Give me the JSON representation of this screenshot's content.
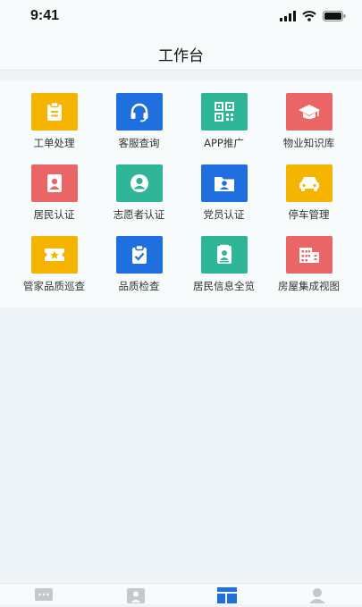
{
  "status_bar": {
    "time": "9:41"
  },
  "header": {
    "title": "工作台"
  },
  "grid": {
    "items": [
      {
        "label": "工单处理",
        "icon": "clipboard-icon",
        "color": "#f4b400"
      },
      {
        "label": "客服查询",
        "icon": "headset-icon",
        "color": "#1f6fde"
      },
      {
        "label": "APP推广",
        "icon": "qrcode-icon",
        "color": "#2fb597"
      },
      {
        "label": "物业知识库",
        "icon": "graduation-cap-icon",
        "color": "#ea6666"
      },
      {
        "label": "居民认证",
        "icon": "id-badge-icon",
        "color": "#ea6666"
      },
      {
        "label": "志愿者认证",
        "icon": "user-circle-icon",
        "color": "#2fb597"
      },
      {
        "label": "党员认证",
        "icon": "folder-user-icon",
        "color": "#1f6fde"
      },
      {
        "label": "停车管理",
        "icon": "car-icon",
        "color": "#f4b400"
      },
      {
        "label": "管家品质巡查",
        "icon": "ticket-star-icon",
        "color": "#f4b400"
      },
      {
        "label": "品质检查",
        "icon": "clipboard-check-icon",
        "color": "#1f6fde"
      },
      {
        "label": "居民信息全览",
        "icon": "contact-card-icon",
        "color": "#2fb597"
      },
      {
        "label": "房屋集成视图",
        "icon": "building-icon",
        "color": "#ea6666"
      }
    ]
  },
  "tabbar": {
    "tabs": [
      {
        "icon": "chat-icon",
        "active": false
      },
      {
        "icon": "contacts-icon",
        "active": false
      },
      {
        "icon": "workspace-icon",
        "active": true
      },
      {
        "icon": "profile-icon",
        "active": false
      }
    ]
  }
}
